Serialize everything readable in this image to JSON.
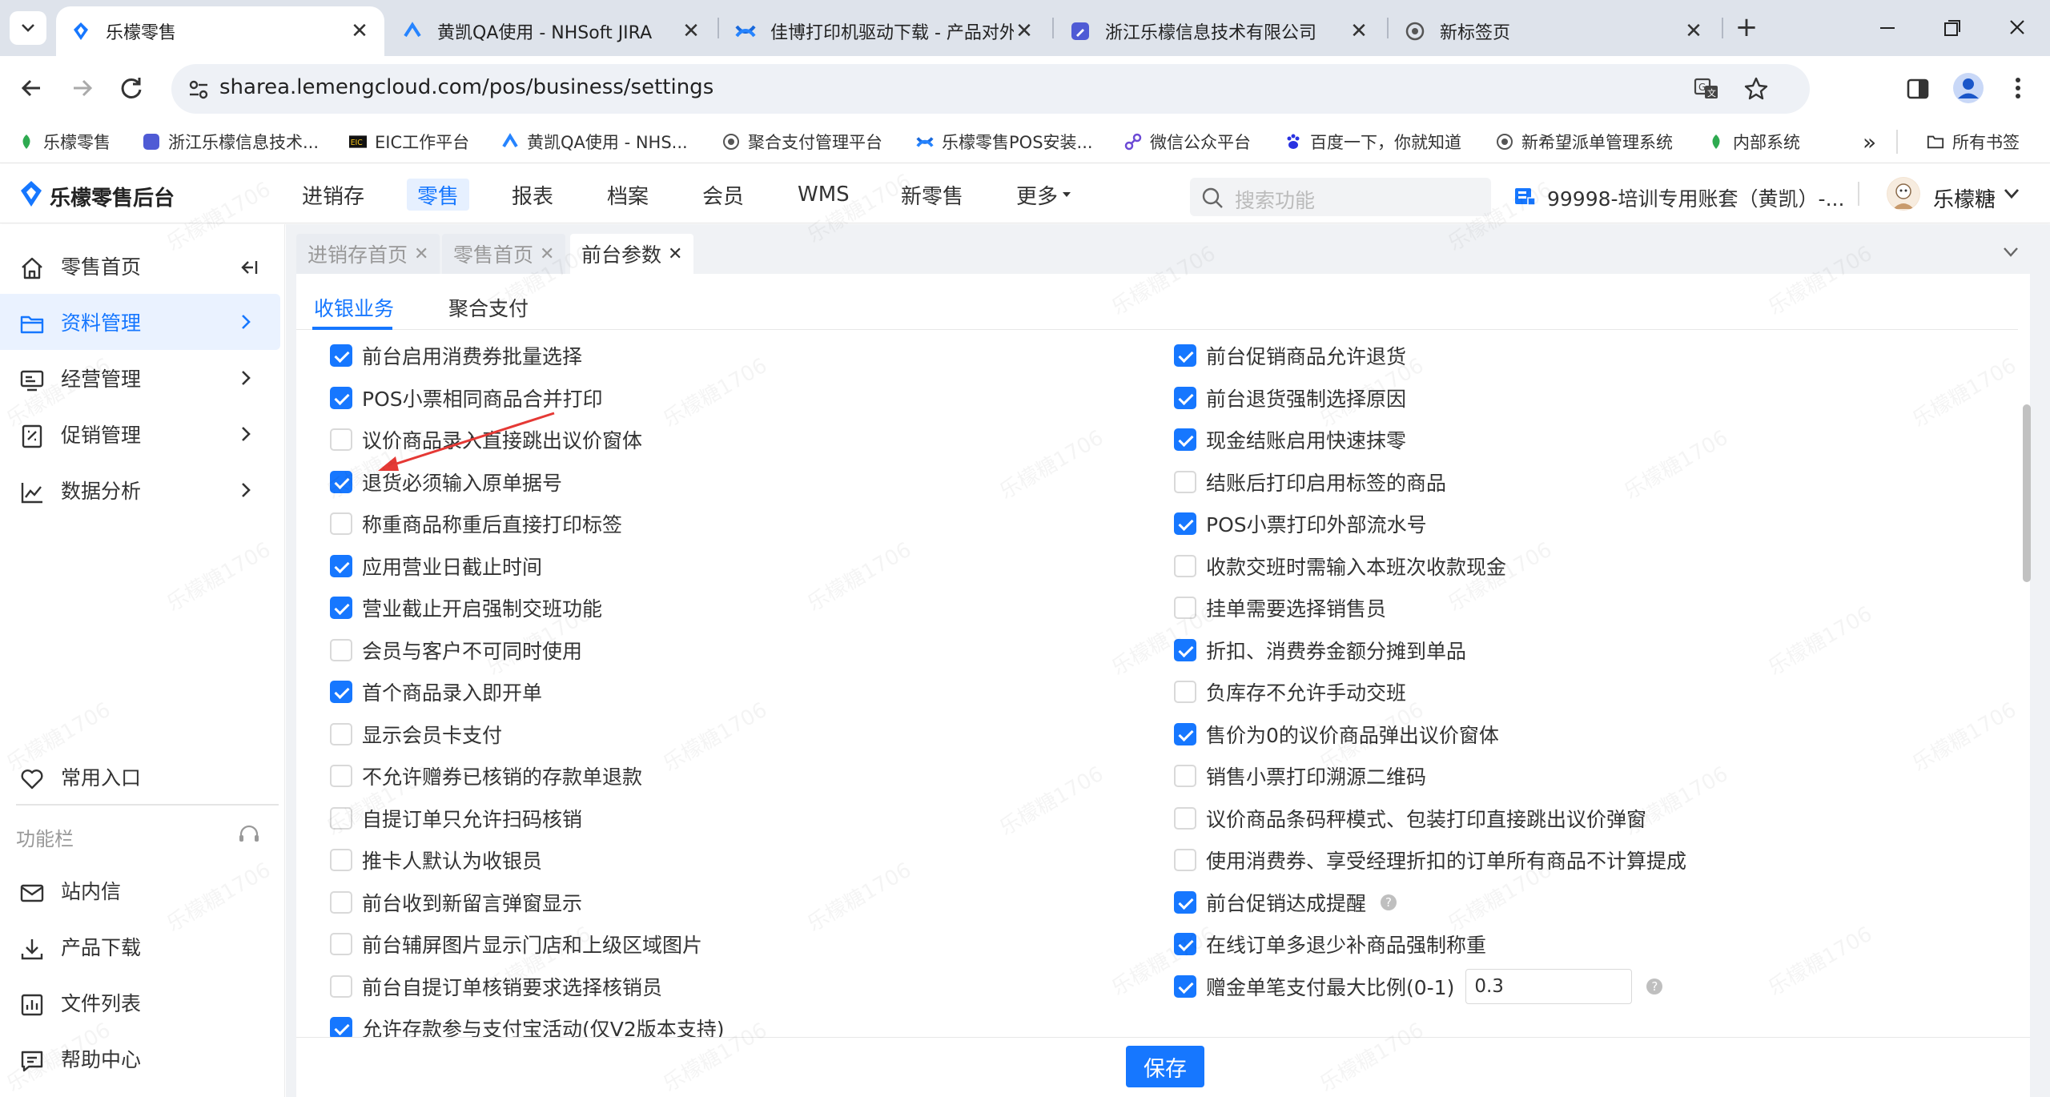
{
  "browser": {
    "tabs": [
      {
        "title": "乐檬零售",
        "active": true
      },
      {
        "title": "黄凯QA使用 - NHSoft JIRA"
      },
      {
        "title": "佳博打印机驱动下载 - 产品对外"
      },
      {
        "title": "浙江乐檬信息技术有限公司"
      },
      {
        "title": "新标签页"
      }
    ],
    "new_tab": "+",
    "url": "sharea.lemengcloud.com/pos/business/settings",
    "bookmarks": [
      "乐檬零售",
      "浙江乐檬信息技术...",
      "EIC工作平台",
      "黄凯QA使用 - NHS...",
      "聚合支付管理平台",
      "乐檬零售POS安装...",
      "微信公众平台",
      "百度一下，你就知道",
      "新希望派单管理系统",
      "内部系统"
    ],
    "bookmarks_overflow": "»",
    "all_bookmarks": "所有书签"
  },
  "app": {
    "logo": "乐檬零售后台",
    "nav": [
      "进销存",
      "零售",
      "报表",
      "档案",
      "会员",
      "WMS",
      "新零售",
      "更多"
    ],
    "active_nav": "零售",
    "search_placeholder": "搜索功能",
    "account": "99998-培训专用账套（黄凯）-...",
    "user": "乐檬糖"
  },
  "sidebar": {
    "items": [
      {
        "label": "零售首页",
        "icon": "home-icon"
      },
      {
        "label": "资料管理",
        "icon": "folder-icon",
        "active": true
      },
      {
        "label": "经营管理",
        "icon": "monitor-icon"
      },
      {
        "label": "促销管理",
        "icon": "promotion-icon"
      },
      {
        "label": "数据分析",
        "icon": "chart-icon"
      }
    ],
    "favorites": "常用入口",
    "toolbar_title": "功能栏",
    "tools": [
      {
        "label": "站内信",
        "icon": "mail-icon"
      },
      {
        "label": "产品下载",
        "icon": "download-icon"
      },
      {
        "label": "文件列表",
        "icon": "file-list-icon"
      },
      {
        "label": "帮助中心",
        "icon": "help-chat-icon"
      }
    ]
  },
  "page_tabs": [
    {
      "label": "进销存首页"
    },
    {
      "label": "零售首页"
    },
    {
      "label": "前台参数",
      "active": true
    }
  ],
  "sub_tabs": [
    "收银业务",
    "聚合支付"
  ],
  "left_options": [
    {
      "label": "前台启用消费券批量选择",
      "checked": true
    },
    {
      "label": "POS小票相同商品合并打印",
      "checked": true
    },
    {
      "label": "议价商品录入直接跳出议价窗体",
      "checked": false
    },
    {
      "label": "退货必须输入原单据号",
      "checked": true
    },
    {
      "label": "称重商品称重后直接打印标签",
      "checked": false
    },
    {
      "label": "应用营业日截止时间",
      "checked": true
    },
    {
      "label": "营业截止开启强制交班功能",
      "checked": true
    },
    {
      "label": "会员与客户不可同时使用",
      "checked": false
    },
    {
      "label": "首个商品录入即开单",
      "checked": true
    },
    {
      "label": "显示会员卡支付",
      "checked": false
    },
    {
      "label": "不允许赠券已核销的存款单退款",
      "checked": false
    },
    {
      "label": "自提订单只允许扫码核销",
      "checked": false
    },
    {
      "label": "推卡人默认为收银员",
      "checked": false
    },
    {
      "label": "前台收到新留言弹窗显示",
      "checked": false
    },
    {
      "label": "前台辅屏图片显示门店和上级区域图片",
      "checked": false
    },
    {
      "label": "前台自提订单核销要求选择核销员",
      "checked": false
    },
    {
      "label": "允许存款参与支付宝活动(仅V2版本支持)",
      "checked": true
    }
  ],
  "right_options": [
    {
      "label": "前台促销商品允许退货",
      "checked": true
    },
    {
      "label": "前台退货强制选择原因",
      "checked": true
    },
    {
      "label": "现金结账启用快速抹零",
      "checked": true
    },
    {
      "label": "结账后打印启用标签的商品",
      "checked": false
    },
    {
      "label": "POS小票打印外部流水号",
      "checked": true
    },
    {
      "label": "收款交班时需输入本班次收款现金",
      "checked": false
    },
    {
      "label": "挂单需要选择销售员",
      "checked": false
    },
    {
      "label": "折扣、消费券金额分摊到单品",
      "checked": true
    },
    {
      "label": "负库存不允许手动交班",
      "checked": false
    },
    {
      "label": "售价为0的议价商品弹出议价窗体",
      "checked": true
    },
    {
      "label": "销售小票打印溯源二维码",
      "checked": false
    },
    {
      "label": "议价商品条码秤模式、包装打印直接跳出议价弹窗",
      "checked": false
    },
    {
      "label": "使用消费券、享受经理折扣的订单所有商品不计算提成",
      "checked": false
    },
    {
      "label": "前台促销达成提醒",
      "checked": true,
      "help": "?"
    },
    {
      "label": "在线订单多退少补商品强制称重",
      "checked": true
    },
    {
      "label": "赠金单笔支付最大比例(0-1)",
      "checked": true,
      "value": "0.3",
      "help": "?"
    }
  ],
  "save_label": "保存",
  "watermark": "乐檬糖1706",
  "colors": {
    "accent": "#1677ff",
    "tabbar": "#dee3eb",
    "content_bg": "#f0f2f5"
  }
}
